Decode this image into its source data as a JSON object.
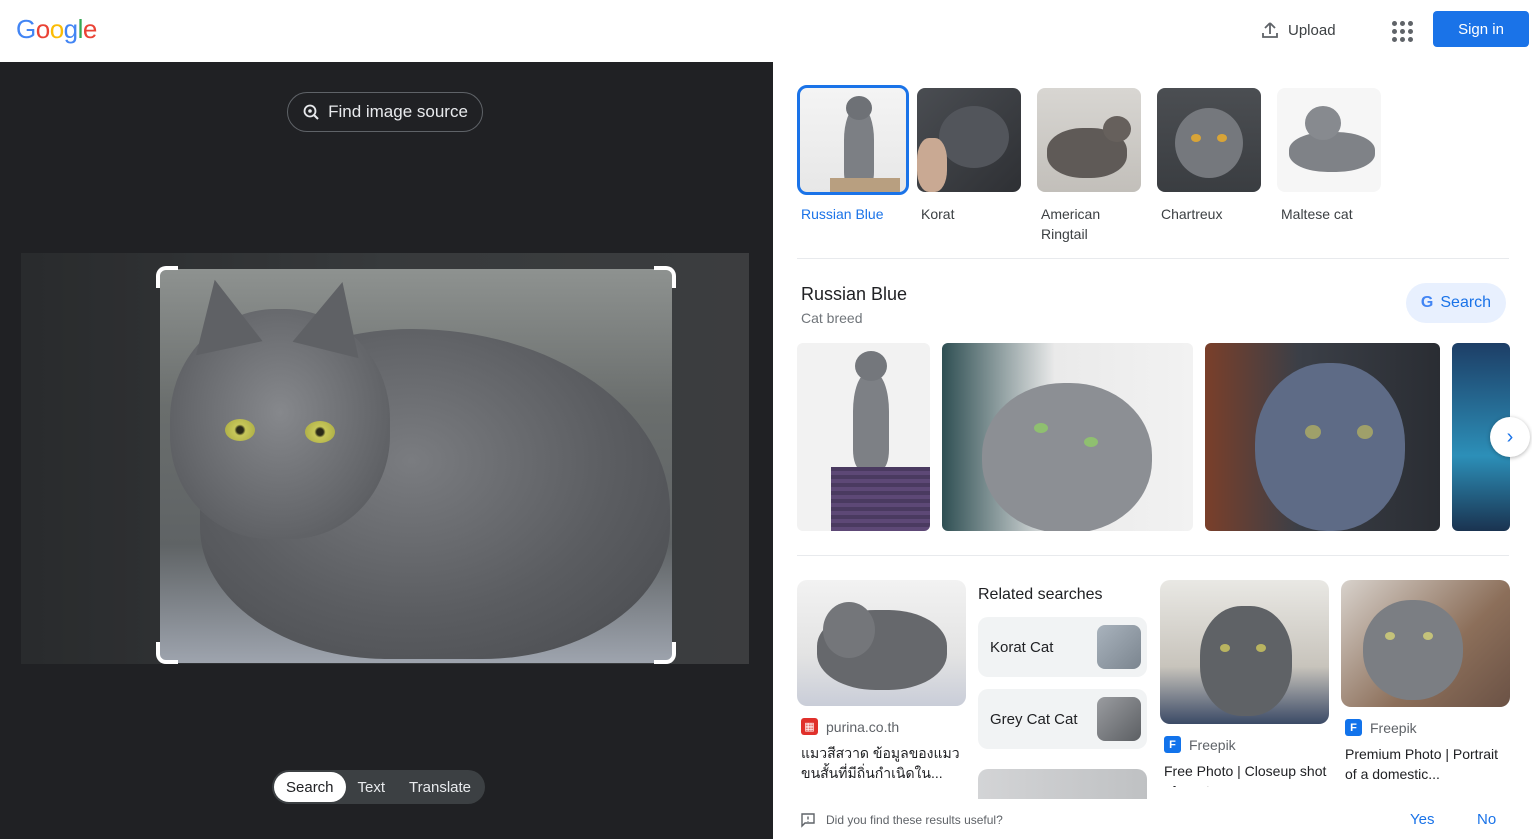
{
  "header": {
    "logo_letters": [
      {
        "ch": "G",
        "color": "#4285F4"
      },
      {
        "ch": "o",
        "color": "#EA4335"
      },
      {
        "ch": "o",
        "color": "#FBBC05"
      },
      {
        "ch": "g",
        "color": "#4285F4"
      },
      {
        "ch": "l",
        "color": "#34A853"
      },
      {
        "ch": "e",
        "color": "#EA4335"
      }
    ],
    "upload_label": "Upload",
    "signin_label": "Sign in"
  },
  "lens": {
    "find_source_label": "Find image source",
    "modes": [
      "Search",
      "Text",
      "Translate"
    ],
    "active_mode": "Search"
  },
  "chips": [
    {
      "label": "Russian Blue",
      "selected": true
    },
    {
      "label": "Korat",
      "selected": false
    },
    {
      "label": "American Ringtail",
      "selected": false
    },
    {
      "label": "Chartreux",
      "selected": false
    },
    {
      "label": "Maltese cat",
      "selected": false
    }
  ],
  "knowledge_panel": {
    "title": "Russian Blue",
    "subtitle": "Cat breed",
    "search_label": "Search"
  },
  "results": [
    {
      "source": "purina.co.th",
      "title": "แมวสีสวาด ข้อมูลของแมวขนสั้นที่มีถิ่นกำเนิดใน..."
    },
    {
      "source": "Freepik",
      "title": "Free Photo | Closeup shot of a cute gray ca..."
    },
    {
      "source": "Freepik",
      "title": "Premium Photo | Portrait of a domestic..."
    }
  ],
  "related": {
    "heading": "Related searches",
    "items": [
      "Korat Cat",
      "Grey Cat Cat"
    ]
  },
  "feedback": {
    "question": "Did you find these results useful?",
    "yes": "Yes",
    "no": "No"
  },
  "colors": {
    "accent": "#1a73e8",
    "dark_pane": "#202124"
  }
}
